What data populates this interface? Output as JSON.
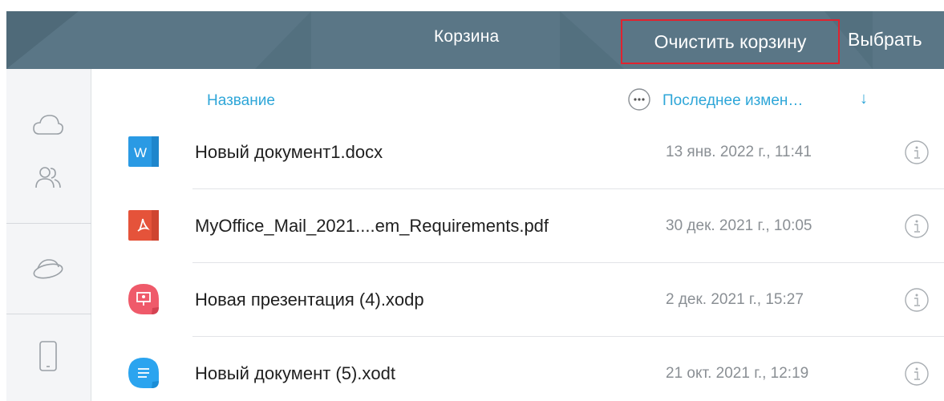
{
  "header": {
    "title": "Корзина",
    "clear_label": "Очистить корзину",
    "select_label": "Выбрать"
  },
  "sidebar": {
    "items": [
      {
        "icon": "cloud-icon"
      },
      {
        "icon": "users-icon"
      },
      {
        "icon": "shared-storage-icon"
      },
      {
        "icon": "device-icon"
      }
    ]
  },
  "columns": {
    "name_label": "Название",
    "date_label": "Последнее измен…",
    "sort_arrow": "↓"
  },
  "files": [
    {
      "name": "Новый документ1.docx",
      "date": "13 янв. 2022 г., 11:41",
      "type": "docx",
      "icon_letter": "W",
      "color": "#2a9ae4"
    },
    {
      "name": "MyOffice_Mail_2021....em_Requirements.pdf",
      "date": "30 дек. 2021 г., 10:05",
      "type": "pdf",
      "color": "#e5533a"
    },
    {
      "name": "Новая презентация (4).xodp",
      "date": "2 дек. 2021 г., 15:27",
      "type": "xodp",
      "color": "#ef5a6a"
    },
    {
      "name": "Новый документ (5).xodt",
      "date": "21 окт. 2021 г., 12:19",
      "type": "xodt",
      "color": "#2ba4ef"
    }
  ],
  "colors": {
    "header_bg": "#5a7686",
    "accent": "#2ea6d8",
    "highlight_border": "#e0232f"
  }
}
